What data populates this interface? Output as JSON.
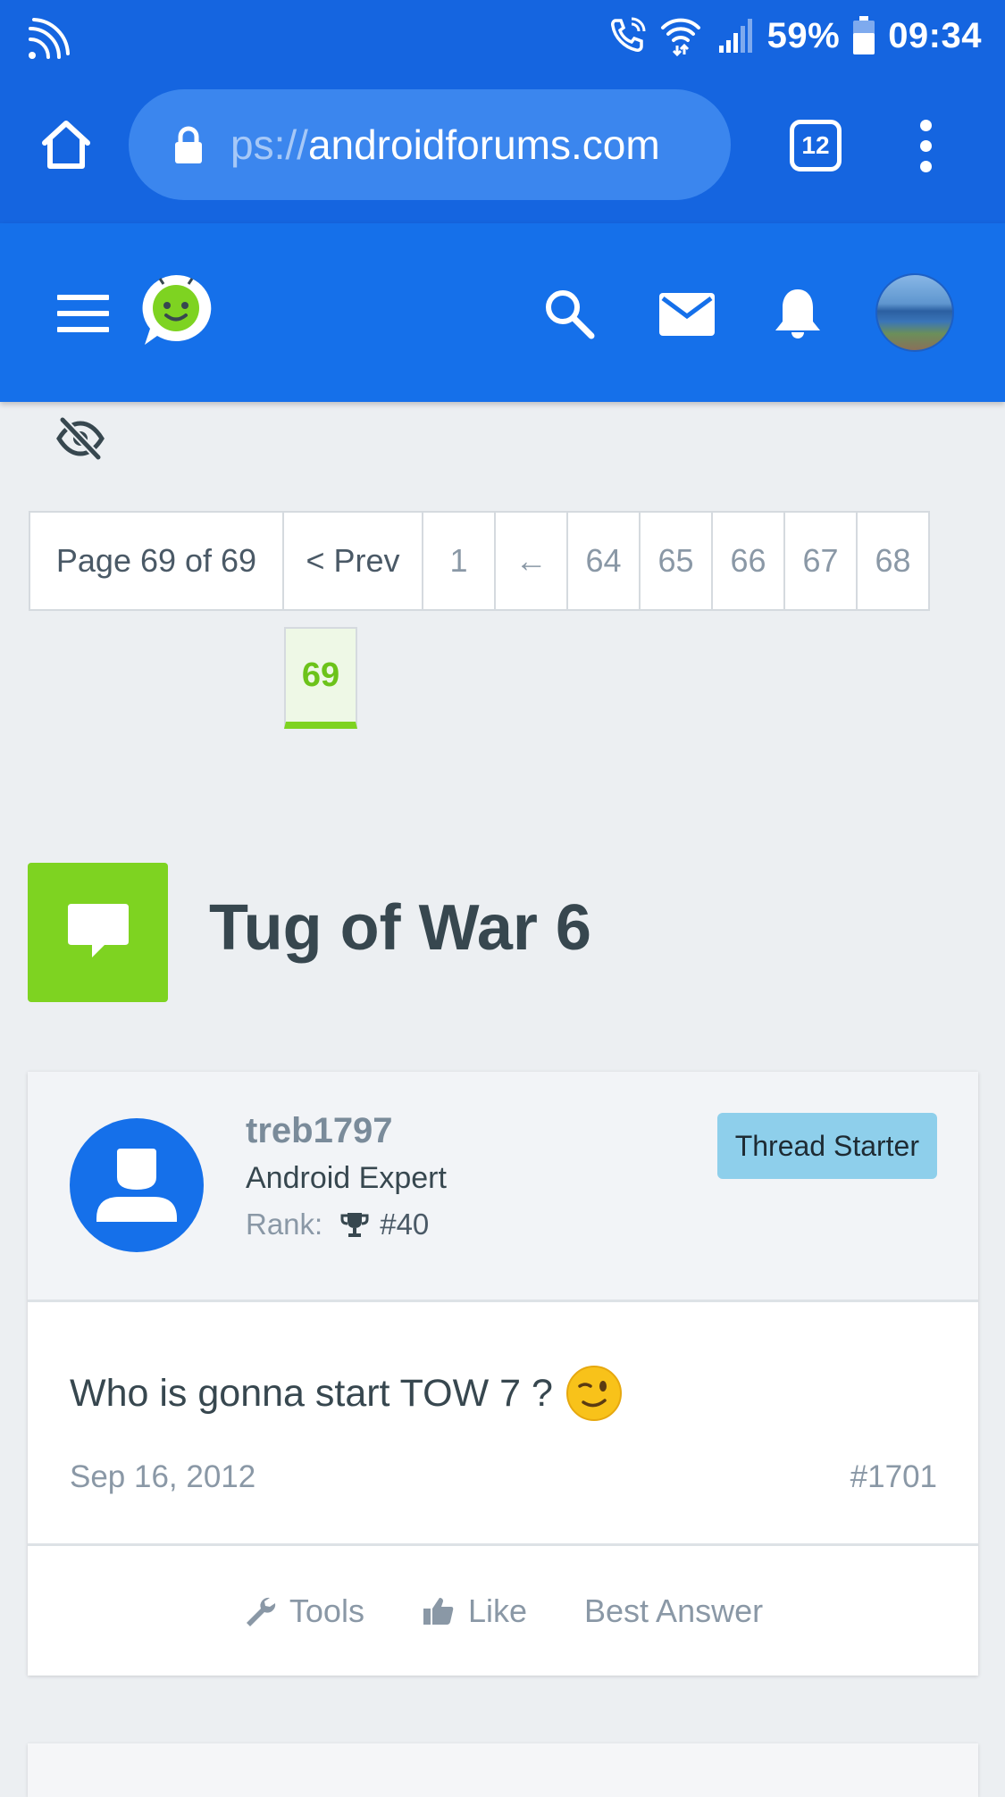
{
  "status_bar": {
    "battery": "59%",
    "time": "09:34",
    "icons": [
      "cast-icon",
      "wifi-call-icon",
      "wifi-icon",
      "signal-icon",
      "battery-icon"
    ]
  },
  "browser": {
    "url_prefix": "ps://",
    "url_host": "androidforums.com",
    "tab_count": "12"
  },
  "site_header": {
    "icons": [
      "menu-icon",
      "site-logo",
      "search-icon",
      "mail-icon",
      "bell-icon",
      "user-avatar"
    ]
  },
  "pagination": {
    "label": "Page 69 of 69",
    "prev": "< Prev",
    "pages": [
      "1",
      "←",
      "64",
      "65",
      "66",
      "67",
      "68"
    ],
    "current": "69"
  },
  "thread": {
    "title": "Tug of War 6"
  },
  "post": {
    "username": "treb1797",
    "user_title": "Android Expert",
    "rank_label": "Rank:",
    "rank_value": "#40",
    "badge": "Thread Starter",
    "body": "Who is gonna start TOW 7 ?",
    "date": "Sep 16, 2012",
    "number": "#1701",
    "actions": {
      "tools": "Tools",
      "like": "Like",
      "best_answer": "Best Answer"
    }
  },
  "colors": {
    "primary_blue": "#1570ea",
    "accent_green": "#7ed321",
    "badge_blue": "#8ecfeb"
  }
}
